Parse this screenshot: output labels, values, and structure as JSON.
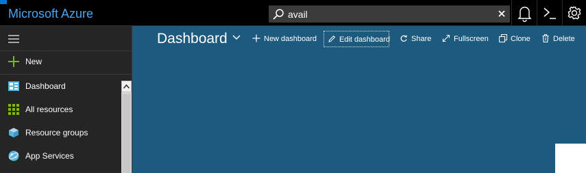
{
  "app": {
    "title": "Microsoft Azure",
    "accent_color": "#4aa5f0",
    "header_color": "#000000",
    "dashboard_bg": "#1d5a7e",
    "sidebar_bg": "#252526"
  },
  "search": {
    "value": "avail",
    "icon": "search-icon",
    "clear_icon": "close-icon"
  },
  "topbar_icons": [
    "bell-icon",
    "cloud-shell-icon",
    "gear-icon"
  ],
  "sidebar": {
    "menu_icon": "hamburger-icon",
    "new": {
      "label": "New",
      "icon": "plus-icon",
      "color": "#7fba00"
    },
    "items": [
      {
        "label": "Dashboard",
        "icon": "dashboard-icon"
      },
      {
        "label": "All resources",
        "icon": "grid-icon"
      },
      {
        "label": "Resource groups",
        "icon": "cube-icon"
      },
      {
        "label": "App Services",
        "icon": "globe-icon"
      }
    ]
  },
  "main": {
    "title": "Dashboard",
    "commands": [
      {
        "label": "New dashboard",
        "icon": "plus-icon"
      },
      {
        "label": "Edit dashboard",
        "icon": "pencil-icon",
        "focused": true
      },
      {
        "label": "Share",
        "icon": "share-icon"
      },
      {
        "label": "Fullscreen",
        "icon": "fullscreen-icon"
      },
      {
        "label": "Clone",
        "icon": "clone-icon"
      },
      {
        "label": "Delete",
        "icon": "trash-icon"
      }
    ]
  }
}
